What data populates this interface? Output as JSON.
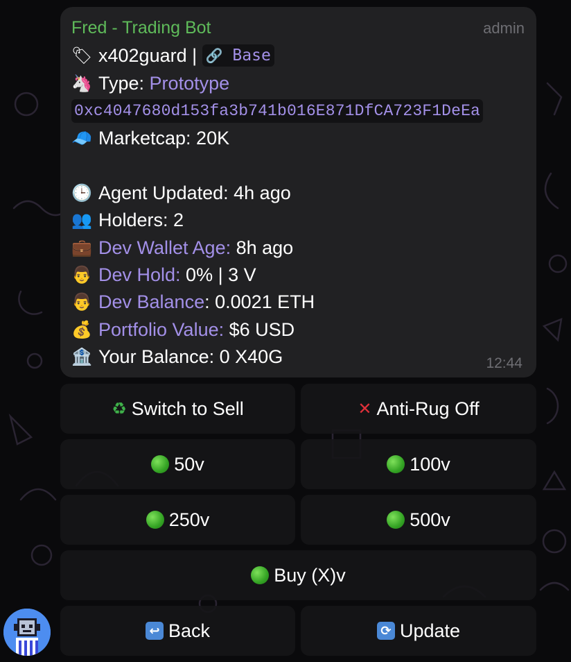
{
  "message": {
    "sender": "Fred - Trading Bot",
    "role": "admin",
    "time": "12:44",
    "token_line": {
      "icon": "label-tag-icon",
      "name": "x402guard",
      "separator": " | ",
      "chain_icon": "link-icon",
      "chain": "Base"
    },
    "type_line": {
      "icon": "unicorn-icon",
      "label": "Type: ",
      "value": "Prototype"
    },
    "address": "0xc4047680d153fa3b741b016E871DfCA723F1DeEa",
    "marketcap": {
      "icon": "cap-icon",
      "text": "Marketcap: 20K"
    },
    "agent_updated": {
      "icon": "clock-icon",
      "text": "Agent Updated: 4h ago"
    },
    "holders": {
      "icon": "people-icon",
      "text": "Holders: 2"
    },
    "dev_wallet_age": {
      "icon": "briefcase-icon",
      "label": "Dev Wallet Age:",
      "value": " 8h ago"
    },
    "dev_hold": {
      "icon": "person-icon",
      "label": "Dev Hold:",
      "value": " 0% | 3 V"
    },
    "dev_balance": {
      "icon": "person-icon",
      "label": "Dev Balance",
      "value": ": 0.0021 ETH"
    },
    "portfolio_value": {
      "icon": "money-bag-icon",
      "label": "Portfolio Value:",
      "value": " $6 USD"
    },
    "your_balance": {
      "icon": "bank-icon",
      "text": "Your Balance: 0 X40G"
    }
  },
  "buttons": {
    "switch_sell": {
      "icon": "recycle-icon",
      "label": "Switch to Sell"
    },
    "anti_rug": {
      "icon": "red-x-icon",
      "label": "Anti-Rug Off"
    },
    "buy_50": {
      "icon": "green-circle-icon",
      "label": "50v"
    },
    "buy_100": {
      "icon": "green-circle-icon",
      "label": "100v"
    },
    "buy_250": {
      "icon": "green-circle-icon",
      "label": "250v"
    },
    "buy_500": {
      "icon": "green-circle-icon",
      "label": "500v"
    },
    "buy_custom": {
      "icon": "green-circle-icon",
      "label": "Buy (X)v"
    },
    "back": {
      "icon": "return-arrow-icon",
      "label": "Back"
    },
    "update": {
      "icon": "refresh-icon",
      "label": "Update"
    }
  },
  "colors": {
    "sender": "#5fbb5a",
    "accent": "#a390e8",
    "bubble": "#212123",
    "button": "#161618",
    "background": "#0a0a0c"
  }
}
